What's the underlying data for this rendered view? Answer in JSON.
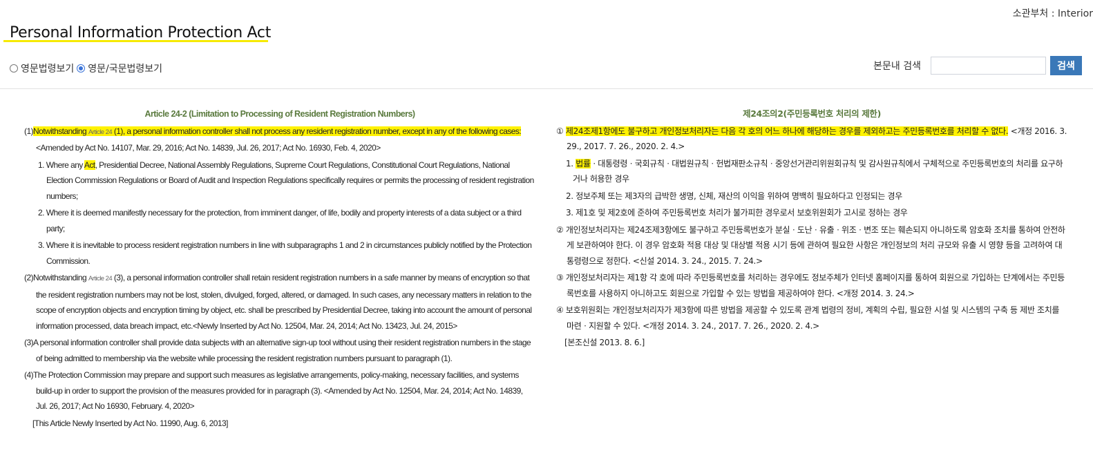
{
  "header": {
    "ministry": "소관부처 : Interior",
    "title": "Personal Information Protection Act",
    "view_options": [
      {
        "label": "영문법령보기",
        "checked": false
      },
      {
        "label": "영문/국문법령보기",
        "checked": true
      }
    ],
    "search_label": "본문내 검색",
    "search_value": "",
    "search_button": "검색"
  },
  "english": {
    "article_title": "Article 24-2 (Limitation to Processing of Resident Registration Numbers)",
    "p1": {
      "num": "(1)",
      "hl_a": "Notwithstanding ",
      "ref": "Article 24",
      "hl_b": " (1), a personal information controller shall not process any resident registration number, except in any of the following cases:",
      "amend": " <Amended by Act No. 14107, Mar. 29, 2016; Act No. 14839, Jul. 26, 2017; Act No. 16930, Feb. 4, 2020>"
    },
    "sub1": {
      "num": "1. ",
      "pre": "Where any ",
      "hl": "Act",
      "post": ", Presidential Decree, National Assembly Regulations, Supreme Court Regulations, Constitutional Court Regulations, National Election Commission Regulations or Board of Audit and Inspection Regulations specifically requires or permits the processing of resident registration numbers;"
    },
    "sub2": {
      "num": "2. ",
      "text": "Where it is deemed manifestly necessary for the protection, from imminent danger, of life, bodily and property interests of a data subject or a third party;"
    },
    "sub3": {
      "num": "3. ",
      "text": "Where it is inevitable to process resident registration numbers in line with subparagraphs 1 and 2 in circumstances publicly notified by the Protection Commission."
    },
    "p2": {
      "num": "(2)",
      "pre": "Notwithstanding ",
      "ref": "Article 24",
      "text": " (3), a personal information controller shall retain resident registration numbers in a safe manner by means of encryption so that the resident registration numbers may not be lost, stolen, divulged, forged, altered, or damaged. In such cases, any necessary matters in relation to the scope of encryption objects and encryption timing by object, etc. shall be prescribed by Presidential Decree, taking into account the amount of personal information processed, data breach impact, etc.<Newly Inserted by Act No. 12504, Mar. 24, 2014; Act No. 13423, Jul. 24, 2015>"
    },
    "p3": {
      "num": "(3)",
      "text": "A personal information controller shall provide data subjects with an alternative sign-up tool without using their resident registration numbers in the stage of being admitted to membership via the website while processing the resident registration numbers pursuant to paragraph (1)."
    },
    "p4": {
      "num": "(4)",
      "text": "The Protection Commission may prepare and support such measures as legislative arrangements, policy-making, necessary facilities, and systems build-up in order to support the provision of the measures provided for in paragraph (3). <Amended by Act No. 12504, Mar. 24, 2014; Act No. 14839, Jul. 26, 2017; Act No 16930, February. 4, 2020>"
    },
    "note": "[This Article Newly Inserted by Act No. 11990, Aug. 6, 2013]"
  },
  "korean": {
    "article_title": "제24조의2(주민등록번호 처리의 제한)",
    "p1": {
      "num": "① ",
      "hl": "제24조제1항에도 불구하고 개인정보처리자는 다음 각 호의 어느 하나에 해당하는 경우를 제외하고는 주민등록번호를 처리할 수 없다.",
      "amend": " <개정 2016. 3. 29., 2017. 7. 26., 2020. 2. 4.>"
    },
    "sub1": {
      "num": "1. ",
      "hl": "법률",
      "post": "ㆍ대통령령ㆍ국회규칙ㆍ대법원규칙ㆍ헌법재판소규칙ㆍ중앙선거관리위원회규칙 및 감사원규칙에서 구체적으로 주민등록번호의 처리를 요구하거나 허용한 경우"
    },
    "sub2": {
      "num": "2. ",
      "text": "정보주체 또는 제3자의 급박한 생명, 신체, 재산의 이익을 위하여 명백히 필요하다고 인정되는 경우"
    },
    "sub3": {
      "num": "3. ",
      "text": "제1호 및 제2호에 준하여 주민등록번호 처리가 불가피한 경우로서 보호위원회가 고시로 정하는 경우"
    },
    "p2": {
      "num": "② ",
      "text": "개인정보처리자는 제24조제3항에도 불구하고 주민등록번호가 분실ㆍ도난ㆍ유출ㆍ위조ㆍ변조 또는 훼손되지 아니하도록 암호화 조치를 통하여 안전하게 보관하여야 한다. 이 경우 암호화 적용 대상 및 대상별 적용 시기 등에 관하여 필요한 사항은 개인정보의 처리 규모와 유출 시 영향 등을 고려하여 대통령령으로 정한다. <신설 2014. 3. 24., 2015. 7. 24.>"
    },
    "p3": {
      "num": "③ ",
      "text": "개인정보처리자는 제1항 각 호에 따라 주민등록번호를 처리하는 경우에도 정보주체가 인터넷 홈페이지를 통하여 회원으로 가입하는 단계에서는 주민등록번호를 사용하지 아니하고도 회원으로 가입할 수 있는 방법을 제공하여야 한다. <개정 2014. 3. 24.>"
    },
    "p4": {
      "num": "④ ",
      "text": "보호위원회는 개인정보처리자가 제3항에 따른 방법을 제공할 수 있도록 관계 법령의 정비, 계획의 수립, 필요한 시설 및 시스템의 구축 등 제반 조치를 마련ㆍ지원할 수 있다. <개정 2014. 3. 24., 2017. 7. 26., 2020. 2. 4.>"
    },
    "note": "[본조신설 2013. 8. 6.]"
  }
}
